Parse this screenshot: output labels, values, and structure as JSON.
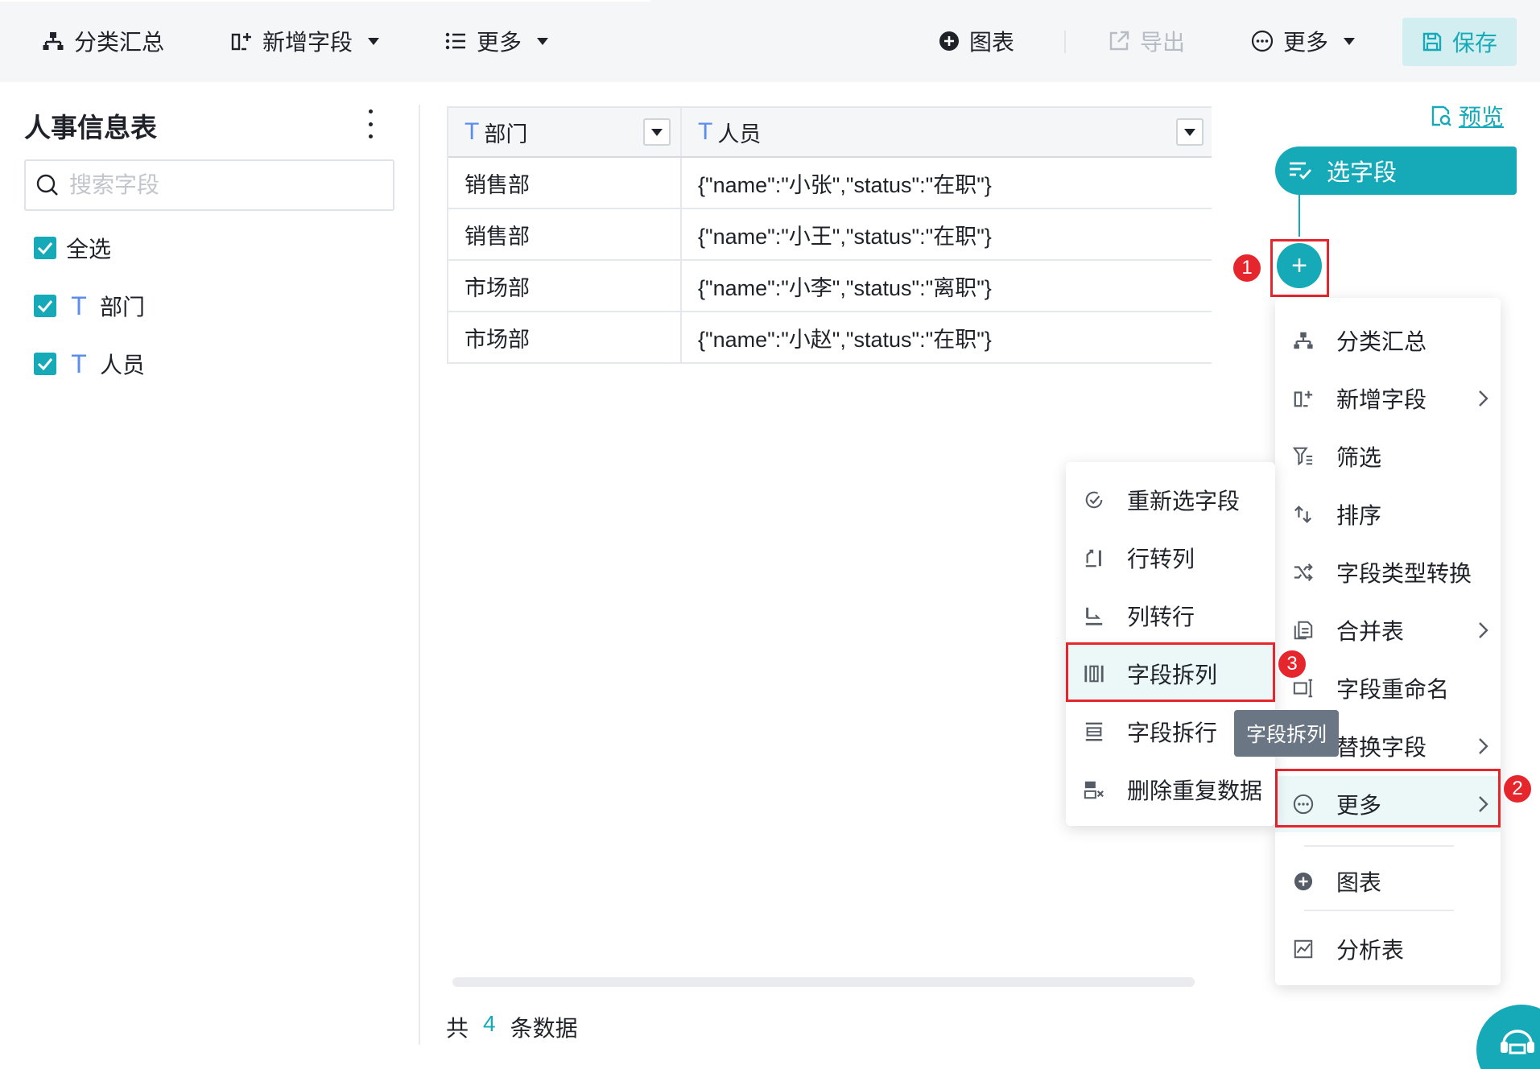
{
  "toolbar": {
    "group_label": "分类汇总",
    "add_field_label": "新增字段",
    "more_label": "更多",
    "chart_label": "图表",
    "export_label": "导出",
    "more_right_label": "更多",
    "save_label": "保存"
  },
  "left_panel": {
    "title": "人事信息表",
    "search_placeholder": "搜索字段",
    "select_all_label": "全选",
    "fields": [
      {
        "type_glyph": "T",
        "name": "部门"
      },
      {
        "type_glyph": "T",
        "name": "人员"
      }
    ]
  },
  "table": {
    "columns": [
      {
        "type_glyph": "T",
        "name": "部门"
      },
      {
        "type_glyph": "T",
        "name": "人员"
      }
    ],
    "rows": [
      [
        "销售部",
        "{\"name\":\"小张\",\"status\":\"在职\"}"
      ],
      [
        "销售部",
        "{\"name\":\"小王\",\"status\":\"在职\"}"
      ],
      [
        "市场部",
        "{\"name\":\"小李\",\"status\":\"离职\"}"
      ],
      [
        "市场部",
        "{\"name\":\"小赵\",\"status\":\"在职\"}"
      ]
    ],
    "footer": {
      "prefix": "共",
      "count": "4",
      "suffix": "条数据"
    }
  },
  "flow": {
    "preview_label": "预览",
    "node_label": "选字段",
    "add_symbol": "+"
  },
  "main_menu": {
    "items": [
      {
        "label": "分类汇总",
        "icon": "group-icon"
      },
      {
        "label": "新增字段",
        "icon": "add-field-icon"
      },
      {
        "label": "筛选",
        "icon": "filter-icon"
      },
      {
        "label": "排序",
        "icon": "sort-icon"
      },
      {
        "label": "字段类型转换",
        "icon": "shuffle-icon"
      },
      {
        "label": "合并表",
        "icon": "merge-table-icon"
      },
      {
        "label": "字段重命名",
        "icon": "rename-icon"
      },
      {
        "label": "替换字段",
        "icon": "replace-icon"
      },
      {
        "label": "更多",
        "icon": "more-circle-icon"
      },
      {
        "label": "图表",
        "icon": "chart-plus-icon"
      },
      {
        "label": "分析表",
        "icon": "analysis-icon"
      }
    ]
  },
  "sub_menu": {
    "items": [
      {
        "label": "重新选字段",
        "icon": "reselect-icon"
      },
      {
        "label": "行转列",
        "icon": "row-to-column-icon"
      },
      {
        "label": "列转行",
        "icon": "column-to-row-icon"
      },
      {
        "label": "字段拆列",
        "icon": "split-column-icon"
      },
      {
        "label": "字段拆行",
        "icon": "split-row-icon"
      },
      {
        "label": "删除重复数据",
        "icon": "dedupe-icon"
      }
    ]
  },
  "tooltip": "字段拆列",
  "annotations": {
    "step1": "1",
    "step2": "2",
    "step3": "3"
  },
  "colors": {
    "accent": "#16aab9",
    "annotation_red": "#e5262d",
    "field_type_blue": "#5b8def"
  }
}
